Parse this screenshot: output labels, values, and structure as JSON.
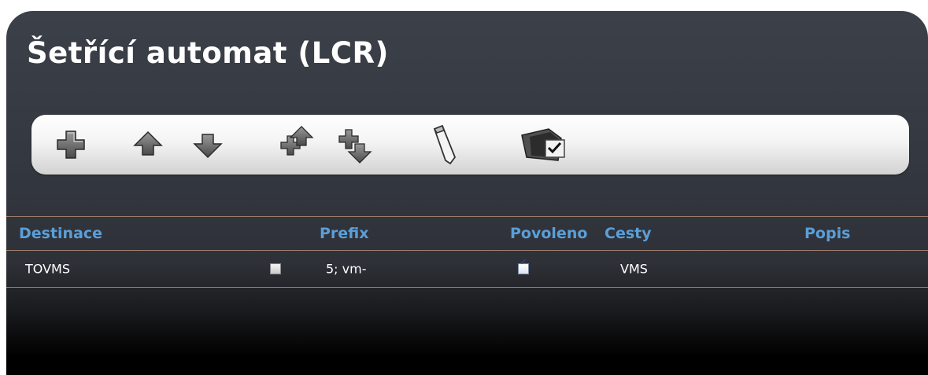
{
  "page": {
    "title": "Šetřící automat (LCR)"
  },
  "toolbar": {
    "buttons": [
      {
        "name": "add",
        "icon": "plus-icon"
      },
      {
        "name": "move-up",
        "icon": "arrow-up-icon"
      },
      {
        "name": "move-down",
        "icon": "arrow-down-icon"
      },
      {
        "name": "move-top",
        "icon": "plus-arrow-up-icon"
      },
      {
        "name": "move-bottom",
        "icon": "plus-arrow-down-icon"
      },
      {
        "name": "edit",
        "icon": "pencil-icon"
      },
      {
        "name": "apply",
        "icon": "folder-check-icon"
      }
    ]
  },
  "table": {
    "headers": {
      "destination": "Destinace",
      "prefix": "Prefix",
      "enabled": "Povoleno",
      "routes": "Cesty",
      "description": "Popis"
    },
    "rows": [
      {
        "destination": "TOVMS",
        "selected": false,
        "prefix": "5; vm-",
        "enabled": true,
        "routes": "VMS",
        "description": ""
      }
    ]
  },
  "colors": {
    "header_text": "#5b9fd8",
    "row_text": "#ffffff",
    "divider": "#b58c78",
    "panel_top": "#3c4048",
    "panel_bottom": "#000000"
  }
}
